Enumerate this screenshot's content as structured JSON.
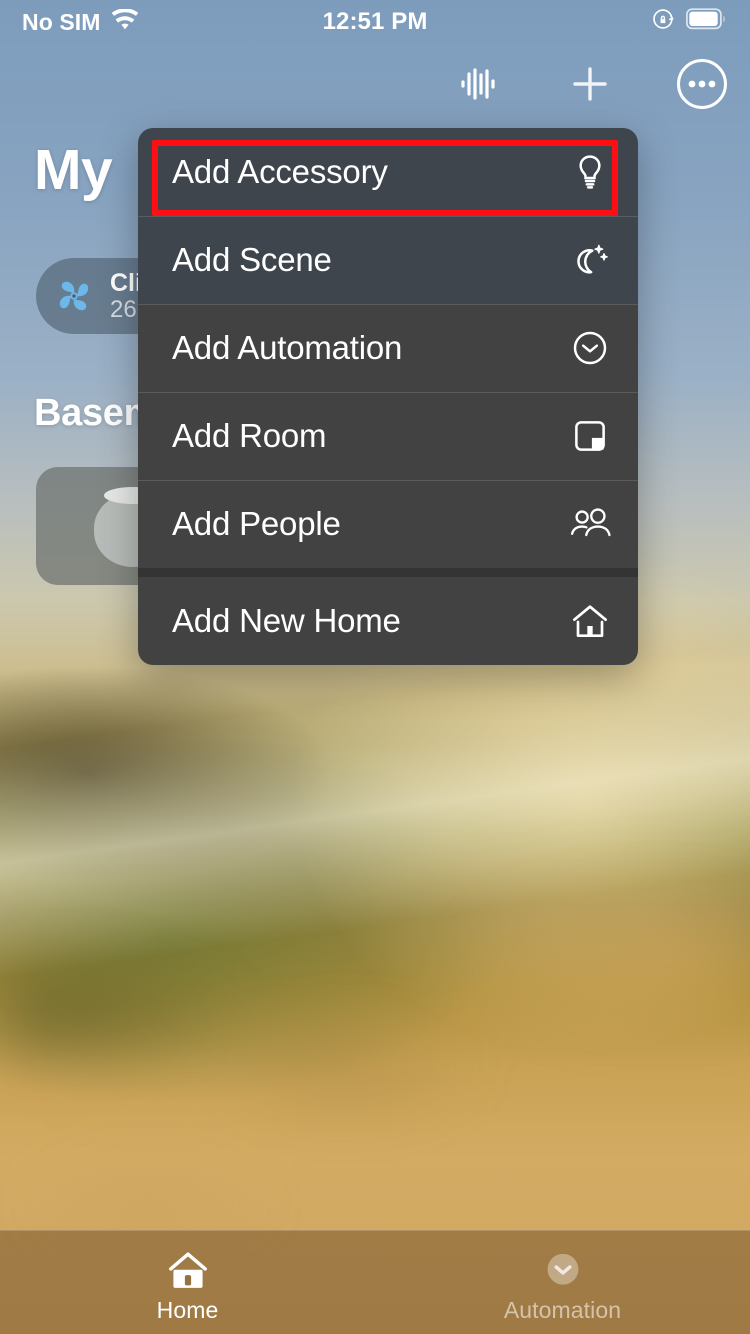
{
  "status_bar": {
    "carrier": "No SIM",
    "wifi_icon": "wifi-icon",
    "time": "12:51 PM",
    "rotation_lock_icon": "rotation-lock-icon",
    "battery_icon": "battery-icon",
    "battery_level_percent": 85
  },
  "nav_bar": {
    "buttons": [
      {
        "name": "audio-waveform-icon",
        "label": "Audio"
      },
      {
        "name": "plus-icon",
        "label": "Add"
      },
      {
        "name": "more-ellipsis-icon",
        "label": "More"
      }
    ]
  },
  "home": {
    "title": "My",
    "status_tile": {
      "icon": "fan-icon",
      "title": "Cli",
      "subtitle": "26",
      "accent_color": "#6cb8ea"
    },
    "room_header": "Basem",
    "accessory_tile": {
      "icon": "homepod-icon"
    }
  },
  "context_menu": {
    "groups": [
      {
        "items": [
          {
            "label": "Add Accessory",
            "icon": "lightbulb-icon",
            "highlighted": true
          },
          {
            "label": "Add Scene",
            "icon": "moon-stars-icon",
            "highlighted": false
          },
          {
            "label": "Add Automation",
            "icon": "clock-icon",
            "highlighted": false
          },
          {
            "label": "Add Room",
            "icon": "room-square-icon",
            "highlighted": false
          },
          {
            "label": "Add People",
            "icon": "people-icon",
            "highlighted": false
          }
        ]
      },
      {
        "items": [
          {
            "label": "Add New Home",
            "icon": "house-icon",
            "highlighted": false
          }
        ]
      }
    ],
    "highlight_color": "#ff0f13",
    "background_color": "#434242",
    "tinted_background_color": "#3e454c",
    "text_color": "#ffffff"
  },
  "tab_bar": {
    "tabs": [
      {
        "label": "Home",
        "icon": "house-tab-icon",
        "active": true
      },
      {
        "label": "Automation",
        "icon": "automation-tab-icon",
        "active": false
      }
    ]
  }
}
